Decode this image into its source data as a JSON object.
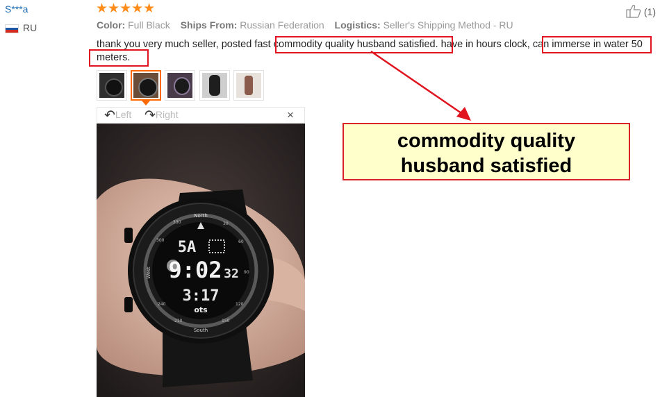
{
  "review": {
    "reviewer_name": "S***a",
    "country": "RU",
    "stars": "★★★★★",
    "rating": 5,
    "attributes": [
      {
        "key": "Color:",
        "value": "Full Black"
      },
      {
        "key": "Ships From:",
        "value": "Russian Federation"
      },
      {
        "key": "Logistics:",
        "value": "Seller's Shipping Method - RU"
      }
    ],
    "text_part1": "thank you very much seller, posted fast ",
    "text_highlight1": "commodity quality husband satisfied.",
    "text_part2": " have in hours clock, ",
    "text_highlight2": "can immerse in water 50 meters.",
    "like_count": "(1)"
  },
  "viewer": {
    "rotate_left_label": "Left",
    "rotate_right_label": "Right",
    "close_label": "×",
    "rotate_left_icon": "rotate-left-icon",
    "rotate_right_icon": "rotate-right-icon"
  },
  "watch_display": {
    "brand": "North",
    "line1": "5A",
    "line2": "9:02",
    "line2_small": "32",
    "line3": "3:17",
    "logo": "ots",
    "bezel_marks": [
      "330",
      "30",
      "60",
      "90",
      "120",
      "150",
      "South",
      "210",
      "240",
      "West",
      "300"
    ]
  },
  "callout": {
    "line1": "commodity quality",
    "line2": "husband satisfied",
    "colors": {
      "fill": "#ffffcc",
      "border": "#d9252a"
    }
  },
  "colors": {
    "accent_orange": "#ff6a00",
    "star_orange": "#ff8c1a",
    "highlight_red": "#e0141e",
    "reviewer_blue": "#1f6fb5"
  }
}
